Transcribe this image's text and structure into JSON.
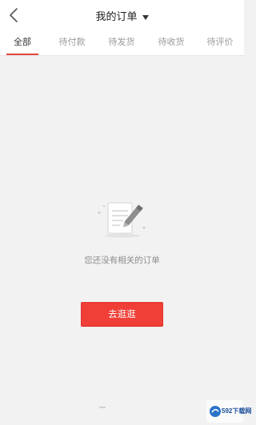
{
  "header": {
    "title": "我的订单"
  },
  "tabs": [
    {
      "label": "全部",
      "active": true
    },
    {
      "label": "待付款",
      "active": false
    },
    {
      "label": "待发货",
      "active": false
    },
    {
      "label": "待收货",
      "active": false
    },
    {
      "label": "待评价",
      "active": false
    }
  ],
  "empty_state": {
    "message": "您还没有相关的订单",
    "button_label": "去逛逛"
  },
  "watermark": {
    "text": "592下载网"
  },
  "colors": {
    "accent": "#ef3f37",
    "background": "#f2f2f2"
  },
  "icons": {
    "back": "chevron-left-icon",
    "dropdown": "caret-down-icon",
    "empty": "document-pen-icon"
  }
}
